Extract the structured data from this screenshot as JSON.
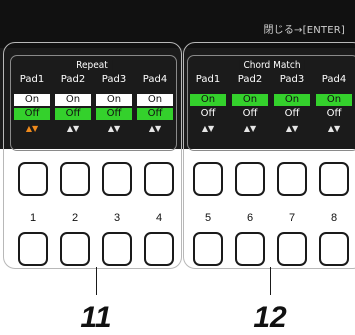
{
  "screen": {
    "close_hint": "閉じる→[ENTER]"
  },
  "repeat_group": {
    "title": "Repeat",
    "pads": [
      {
        "label": "Pad1",
        "on": "On",
        "off": "Off",
        "arrows": "▲▼",
        "arrows_active": true
      },
      {
        "label": "Pad2",
        "on": "On",
        "off": "Off",
        "arrows": "▲▼",
        "arrows_active": false
      },
      {
        "label": "Pad3",
        "on": "On",
        "off": "Off",
        "arrows": "▲▼",
        "arrows_active": false
      },
      {
        "label": "Pad4",
        "on": "On",
        "off": "Off",
        "arrows": "▲▼",
        "arrows_active": false
      }
    ],
    "selected_value": "Off"
  },
  "chord_match_group": {
    "title": "Chord Match",
    "pads": [
      {
        "label": "Pad1",
        "on": "On",
        "off": "Off",
        "arrows": "▲▼",
        "arrows_active": false
      },
      {
        "label": "Pad2",
        "on": "On",
        "off": "Off",
        "arrows": "▲▼",
        "arrows_active": false
      },
      {
        "label": "Pad3",
        "on": "On",
        "off": "Off",
        "arrows": "▲▼",
        "arrows_active": false
      },
      {
        "label": "Pad4",
        "on": "On",
        "off": "Off",
        "arrows": "▲▼",
        "arrows_active": false
      }
    ],
    "selected_value": "On"
  },
  "buttons": {
    "numbers": [
      "1",
      "2",
      "3",
      "4",
      "5",
      "6",
      "7",
      "8"
    ]
  },
  "callouts": {
    "left": "11",
    "right": "12"
  },
  "colors": {
    "screen_bg": "#1b1b1b",
    "selected_green": "#34d12c",
    "active_arrow": "#f08a1c"
  }
}
